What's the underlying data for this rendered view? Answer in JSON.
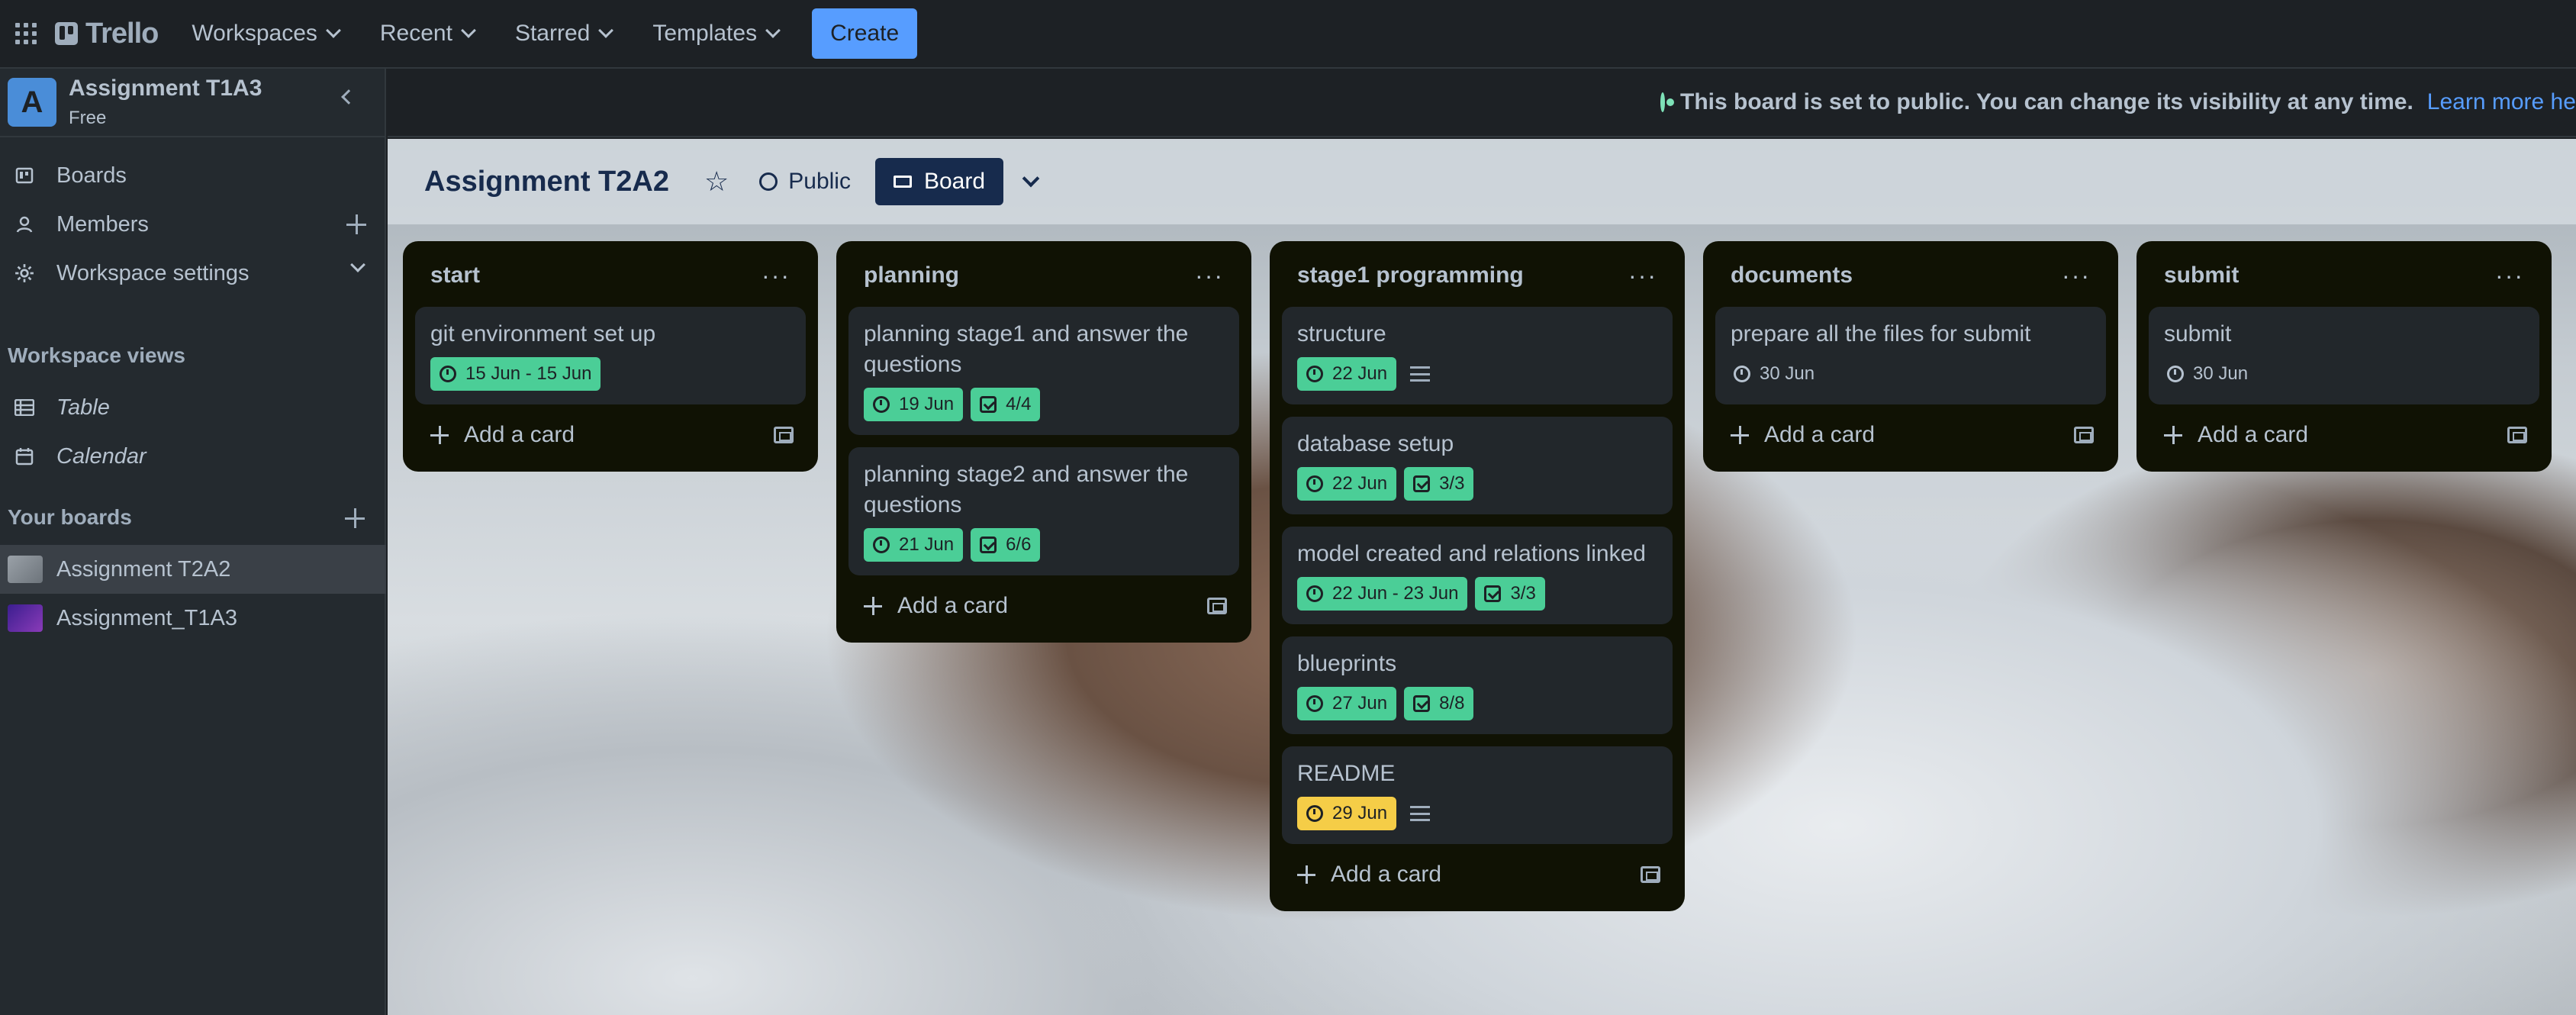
{
  "topbar": {
    "logo": "Trello",
    "nav": [
      "Workspaces",
      "Recent",
      "Starred",
      "Templates"
    ],
    "create_label": "Create"
  },
  "sidebar": {
    "workspace_initial": "A",
    "workspace_name": "Assignment T1A3",
    "workspace_plan": "Free",
    "items": [
      {
        "label": "Boards"
      },
      {
        "label": "Members"
      },
      {
        "label": "Workspace settings"
      }
    ],
    "views_heading": "Workspace views",
    "views": [
      {
        "label": "Table"
      },
      {
        "label": "Calendar"
      }
    ],
    "boards_heading": "Your boards",
    "boards": [
      {
        "label": "Assignment T2A2",
        "color": "#8a9096"
      },
      {
        "label": "Assignment_T1A3",
        "color": "#5b2bb5"
      }
    ]
  },
  "banner": {
    "text": "This board is set to public. You can change its visibility at any time.",
    "link": "Learn more here"
  },
  "board": {
    "title": "Assignment T2A2",
    "visibility": "Public",
    "view": "Board"
  },
  "lists": [
    {
      "title": "start",
      "cards": [
        {
          "title": "git environment set up",
          "date": "15 Jun - 15 Jun",
          "date_style": "green",
          "checklist": "",
          "has_desc": false
        }
      ],
      "add_label": "Add a card"
    },
    {
      "title": "planning",
      "cards": [
        {
          "title": "planning stage1 and answer the questions",
          "date": "19 Jun",
          "date_style": "green",
          "checklist": "4/4",
          "has_desc": false
        },
        {
          "title": "planning stage2 and answer the questions",
          "date": "21 Jun",
          "date_style": "green",
          "checklist": "6/6",
          "has_desc": false
        }
      ],
      "add_label": "Add a card"
    },
    {
      "title": "stage1 programming",
      "cards": [
        {
          "title": "structure",
          "date": "22 Jun",
          "date_style": "green",
          "checklist": "",
          "has_desc": true
        },
        {
          "title": "database setup",
          "date": "22 Jun",
          "date_style": "green",
          "checklist": "3/3",
          "has_desc": false
        },
        {
          "title": "model created and relations linked",
          "date": "22 Jun - 23 Jun",
          "date_style": "green",
          "checklist": "3/3",
          "has_desc": false
        },
        {
          "title": "blueprints",
          "date": "27 Jun",
          "date_style": "green",
          "checklist": "8/8",
          "has_desc": false
        },
        {
          "title": "README",
          "date": "29 Jun",
          "date_style": "yellow",
          "checklist": "",
          "has_desc": true
        }
      ],
      "add_label": "Add a card"
    },
    {
      "title": "documents",
      "cards": [
        {
          "title": "prepare all the files for submit",
          "date": "30 Jun",
          "date_style": "plain",
          "checklist": "",
          "has_desc": false
        }
      ],
      "add_label": "Add a card"
    },
    {
      "title": "submit",
      "cards": [
        {
          "title": "submit",
          "date": "30 Jun",
          "date_style": "plain",
          "checklist": "",
          "has_desc": false
        }
      ],
      "add_label": "Add a card"
    }
  ]
}
